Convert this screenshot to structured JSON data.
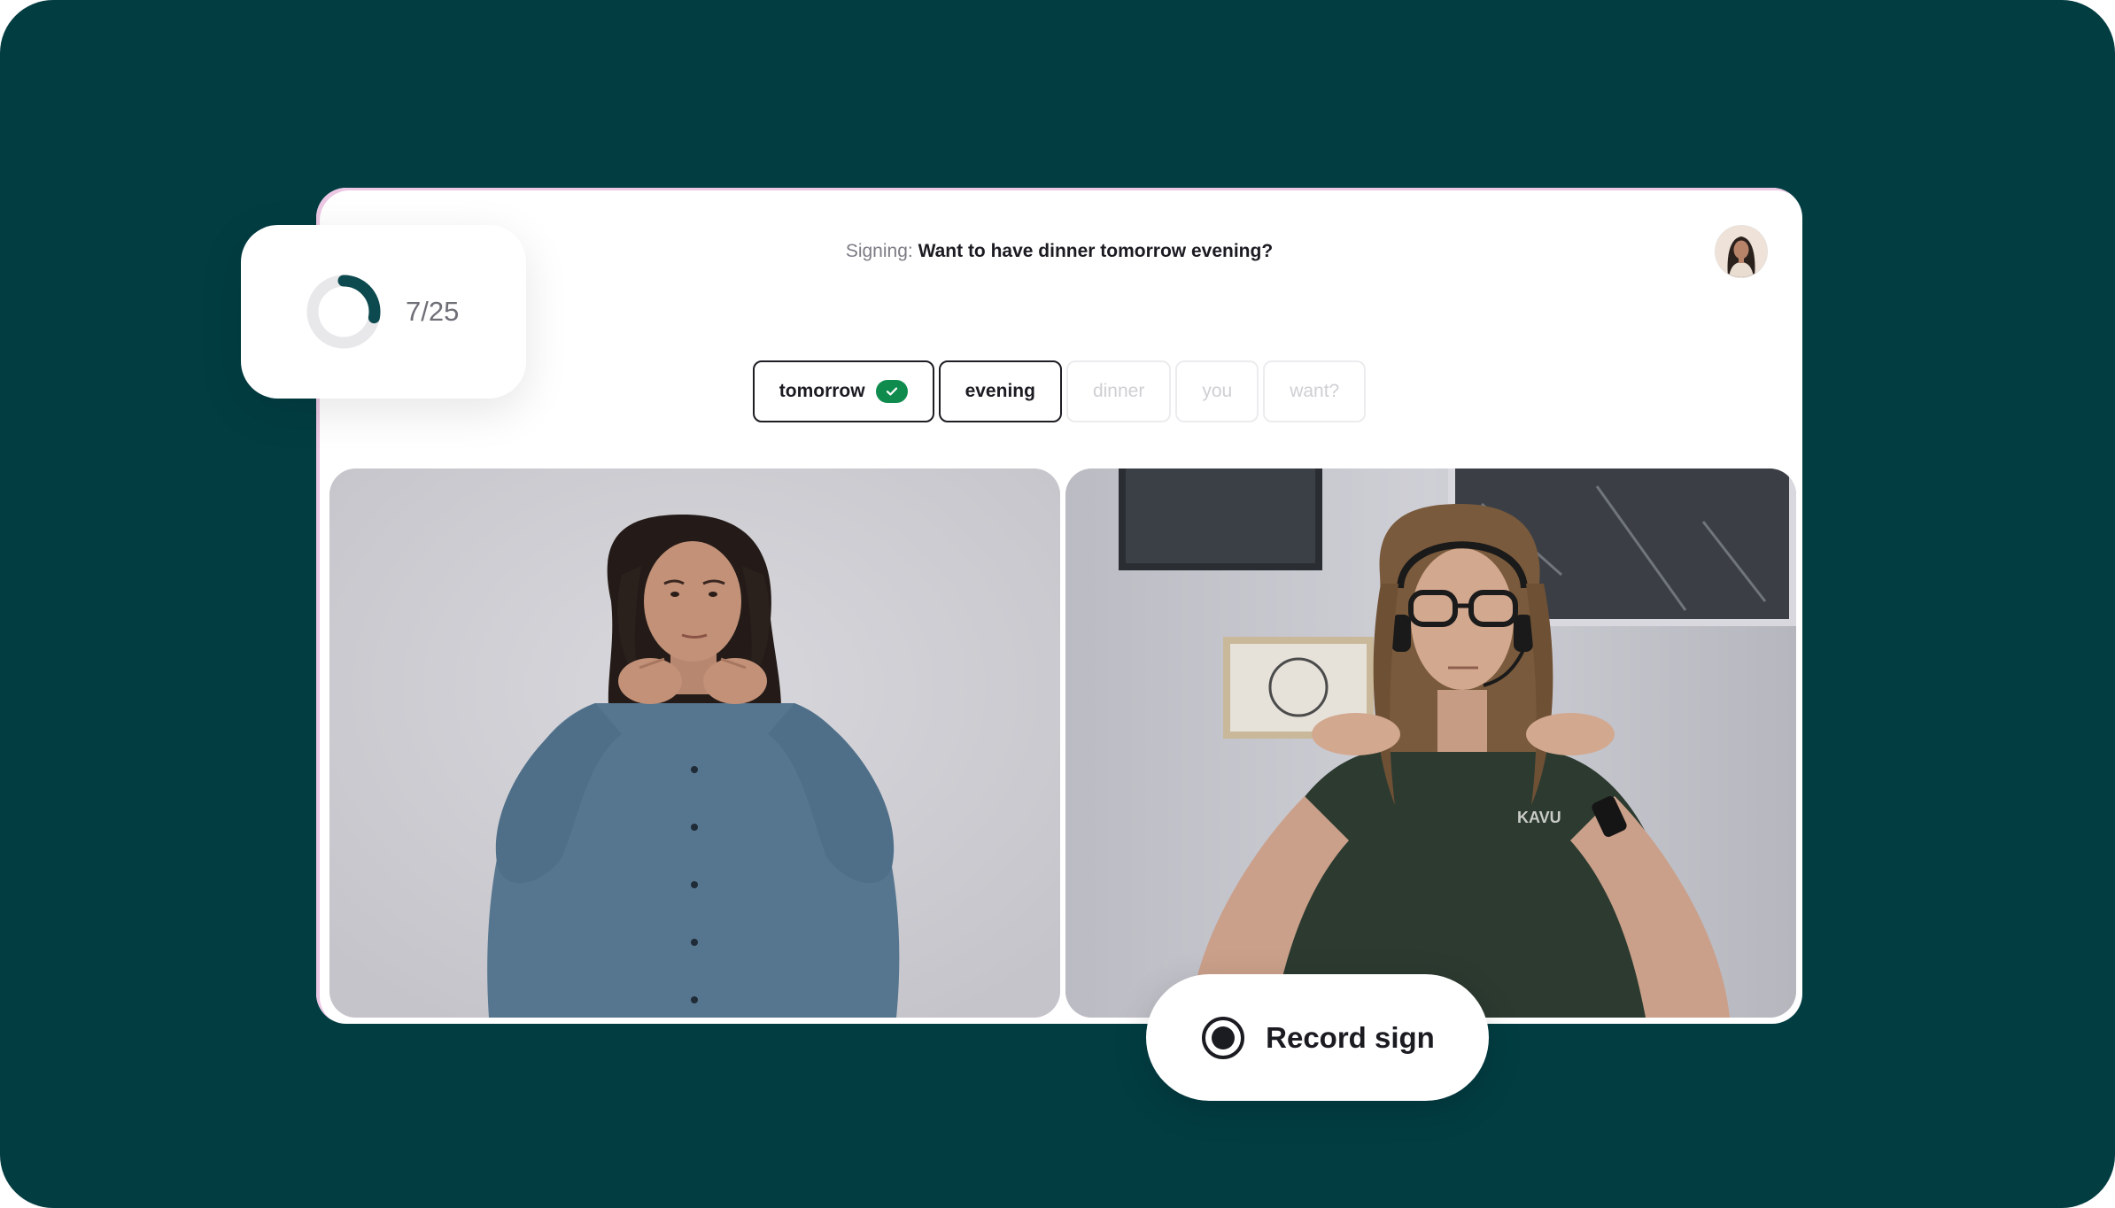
{
  "prompt": {
    "prefix": "Signing:",
    "text": "Want to have dinner tomorrow evening?"
  },
  "avatar": {
    "icon": "user-avatar"
  },
  "progress": {
    "label": "7/25",
    "current": 7,
    "total": 25,
    "accent": "#0d4a4f"
  },
  "words": [
    {
      "label": "tomorrow",
      "state": "done"
    },
    {
      "label": "evening",
      "state": "current"
    },
    {
      "label": "dinner",
      "state": "pending"
    },
    {
      "label": "you",
      "state": "pending"
    },
    {
      "label": "want?",
      "state": "pending"
    }
  ],
  "record": {
    "label": "Record sign",
    "icon": "record-icon"
  },
  "colors": {
    "background": "#023d42",
    "card": "#ffffff",
    "check": "#0f8c4d"
  }
}
